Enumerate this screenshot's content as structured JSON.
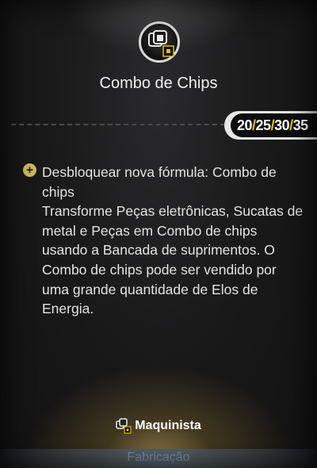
{
  "title": "Combo de Chips",
  "levels": [
    "20",
    "25",
    "30",
    "35"
  ],
  "separator": "/",
  "description": "Desbloquear nova fórmula: Combo de chips\nTransforme Peças eletrônicas, Sucatas de metal e Peças em Combo de chips usando a Bancada de suprimentos. O Combo de chips pode ser vendido por uma grande quantidade de Elos de Energia.",
  "role": "Maquinista",
  "category": "Fabricação",
  "colors": {
    "accent_yellow": "#e2c400",
    "badge_gold": "#ccb75a",
    "footer_text": "#7e95b5"
  },
  "icons": [
    "chip-stack-icon",
    "plus-circle-icon"
  ]
}
